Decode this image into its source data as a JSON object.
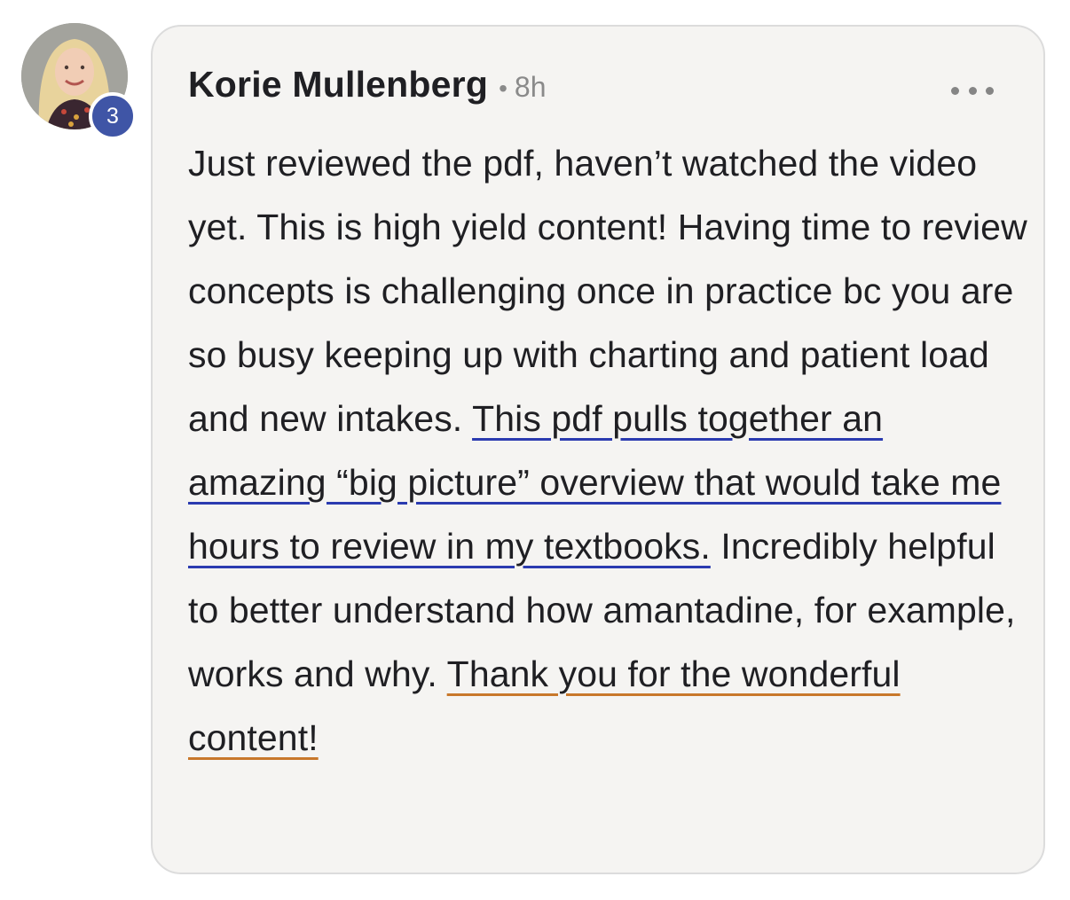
{
  "comment": {
    "author": "Korie Mullenberg",
    "separator": "•",
    "time": "8h",
    "badge_count": "3",
    "text_part_1": "Just reviewed the pdf, haven’t watched the video yet. This is high yield content! Having time to review concepts is challenging once in practice bc you are so busy keeping up with charting and patient load and new intakes. ",
    "text_highlight_blue": "This pdf pulls together an amazing “big picture” overview that would take me hours to review in my textbooks.",
    "text_part_2": " Incredibly helpful to better understand how amantadine, for example, works and why. ",
    "text_highlight_orange": "Thank you for the wonderful content!",
    "more_icon": "more-horizontal-icon"
  },
  "colors": {
    "bubble_background": "#f5f4f2",
    "badge": "#3f55a6",
    "underline_blue": "#2b3bb0",
    "underline_orange": "#c8782b",
    "text": "#1f1f23",
    "muted": "#8a8a8a"
  }
}
